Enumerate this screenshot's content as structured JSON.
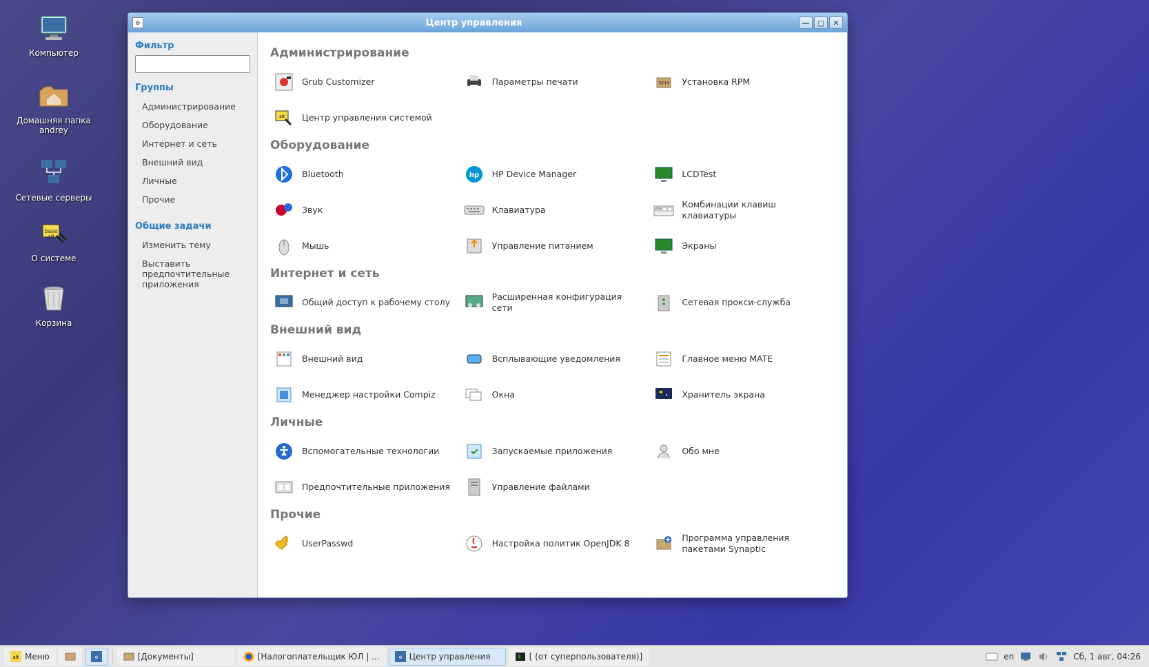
{
  "desktop": {
    "icons": [
      {
        "name": "computer",
        "label": "Компьютер"
      },
      {
        "name": "home",
        "label": "Домашняя папка andrey"
      },
      {
        "name": "network",
        "label": "Сетевые серверы"
      },
      {
        "name": "about",
        "label": "О системе"
      },
      {
        "name": "trash",
        "label": "Корзина"
      }
    ]
  },
  "window": {
    "title": "Центр управления"
  },
  "sidebar": {
    "filter_label": "Фильтр",
    "search_placeholder": "",
    "groups_label": "Группы",
    "groups": [
      "Администрирование",
      "Оборудование",
      "Интернет и сеть",
      "Внешний вид",
      "Личные",
      "Прочие"
    ],
    "tasks_label": "Общие задачи",
    "tasks": [
      "Изменить тему",
      "Выставить предпочтительные приложения"
    ]
  },
  "sections": [
    {
      "title": "Администрирование",
      "items": [
        {
          "icon": "grub",
          "label": "Grub Customizer"
        },
        {
          "icon": "printer",
          "label": "Параметры печати"
        },
        {
          "icon": "rpm",
          "label": "Установка RPM"
        },
        {
          "icon": "altcenter",
          "label": "Центр управления системой"
        }
      ]
    },
    {
      "title": "Оборудование",
      "items": [
        {
          "icon": "bluetooth",
          "label": "Bluetooth"
        },
        {
          "icon": "hp",
          "label": "HP Device Manager"
        },
        {
          "icon": "lcd",
          "label": "LCDTest"
        },
        {
          "icon": "sound",
          "label": "Звук"
        },
        {
          "icon": "keyboard",
          "label": "Клавиатура"
        },
        {
          "icon": "kbshort",
          "label": "Комбинации клавиш клавиатуры"
        },
        {
          "icon": "mouse",
          "label": "Мышь"
        },
        {
          "icon": "power",
          "label": "Управление питанием"
        },
        {
          "icon": "displays",
          "label": "Экраны"
        }
      ]
    },
    {
      "title": "Интернет и сеть",
      "items": [
        {
          "icon": "share",
          "label": "Общий доступ к рабочему столу"
        },
        {
          "icon": "netadv",
          "label": "Расширенная конфигурация сети"
        },
        {
          "icon": "proxy",
          "label": "Сетевая прокси-служба"
        }
      ]
    },
    {
      "title": "Внешний вид",
      "items": [
        {
          "icon": "appearance",
          "label": "Внешний вид"
        },
        {
          "icon": "popup",
          "label": "Всплывающие уведомления"
        },
        {
          "icon": "menu",
          "label": "Главное меню MATE"
        },
        {
          "icon": "compiz",
          "label": "Менеджер настройки Compiz"
        },
        {
          "icon": "windows",
          "label": "Окна"
        },
        {
          "icon": "screensaver",
          "label": "Хранитель экрана"
        }
      ]
    },
    {
      "title": "Личные",
      "items": [
        {
          "icon": "a11y",
          "label": "Вспомогательные технологии"
        },
        {
          "icon": "startup",
          "label": "Запускаемые приложения"
        },
        {
          "icon": "aboutme",
          "label": "Обо мне"
        },
        {
          "icon": "prefapps",
          "label": "Предпочтительные приложения"
        },
        {
          "icon": "files",
          "label": "Управление файлами"
        }
      ]
    },
    {
      "title": "Прочие",
      "items": [
        {
          "icon": "userpasswd",
          "label": "UserPasswd"
        },
        {
          "icon": "openjdk",
          "label": "Настройка политик OpenJDK 8"
        },
        {
          "icon": "synaptic",
          "label": "Программа управления пакетами Synaptic"
        }
      ]
    }
  ],
  "taskbar": {
    "menu": "Меню",
    "tasks": [
      {
        "icon": "fm",
        "label": "[Документы]",
        "active": false
      },
      {
        "icon": "ff",
        "label": "[Налогоплательщик ЮЛ | ...",
        "active": false
      },
      {
        "icon": "cc",
        "label": "Центр управления",
        "active": true
      },
      {
        "icon": "term",
        "label": "[ (от суперпользователя)]",
        "active": false
      }
    ],
    "tray": {
      "lang": "en",
      "clock": "Сб, 1 авг, 04:26"
    }
  }
}
